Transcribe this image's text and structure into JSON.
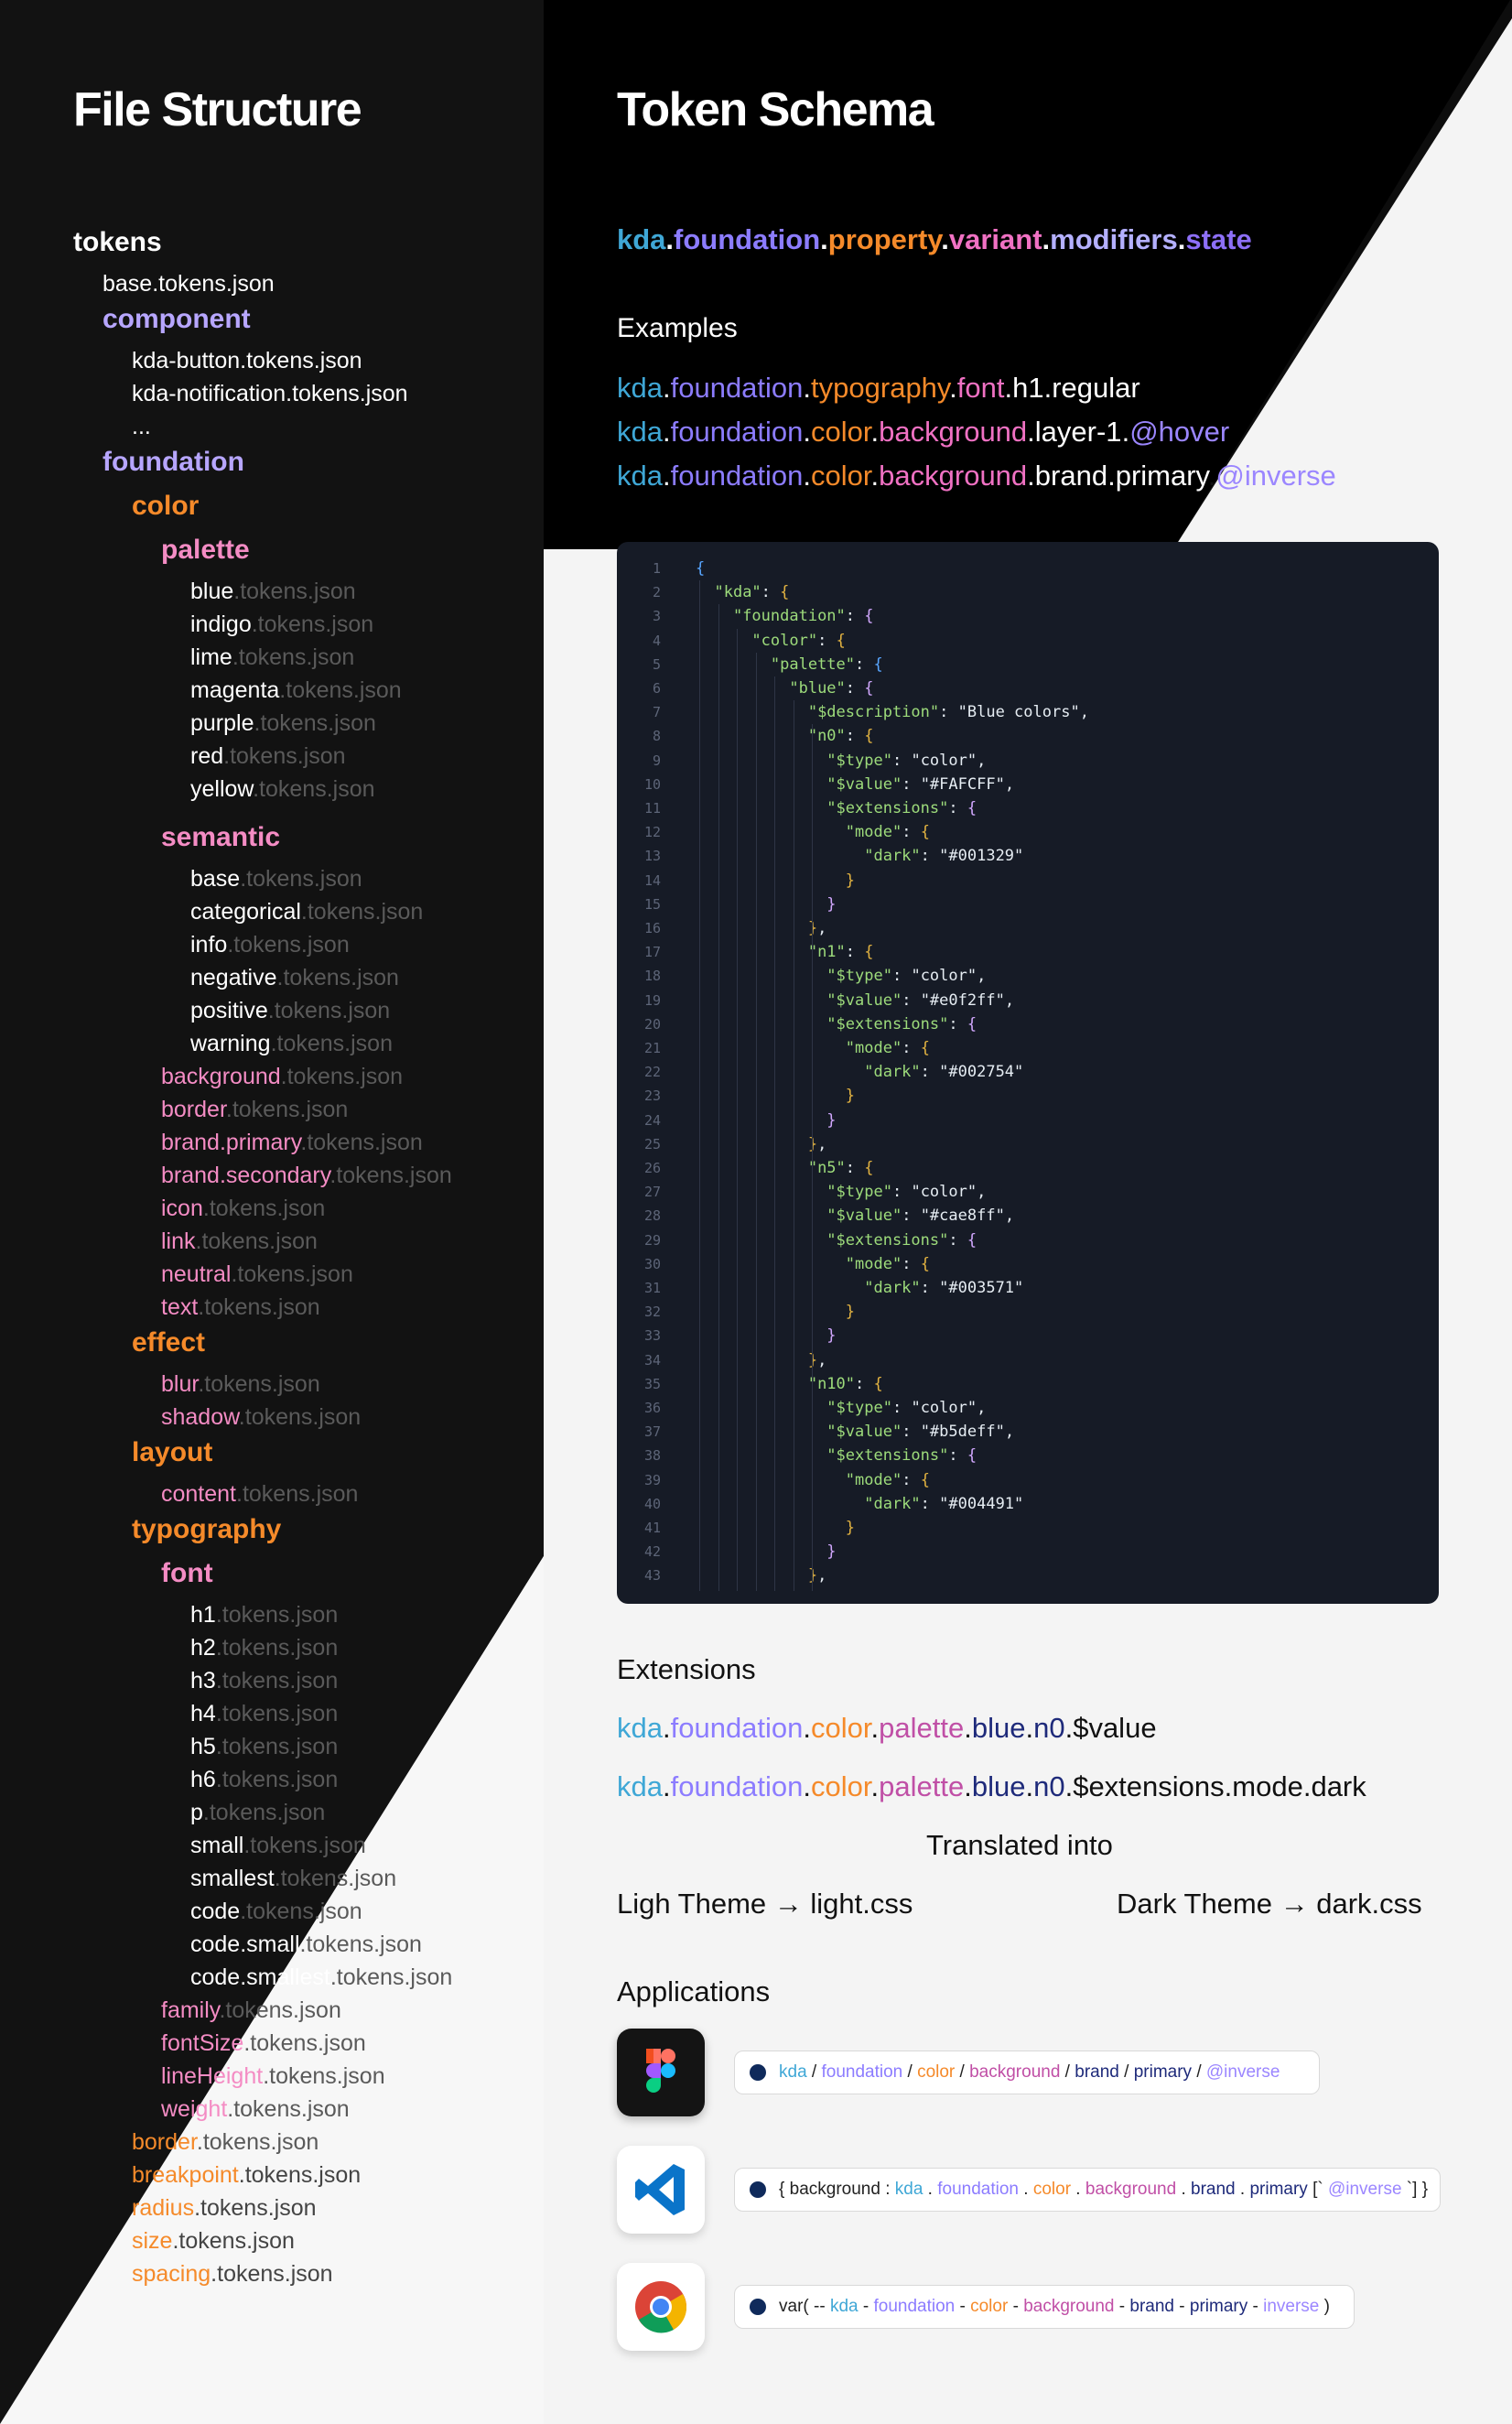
{
  "left_title": "File Structure",
  "right_title": "Token Schema",
  "tree": [
    {
      "name": "tokens",
      "ext": "",
      "style": "root",
      "indent": 0
    },
    {
      "name": "base.tokens.json",
      "ext": "",
      "style": "file",
      "indent": 1
    },
    {
      "name": "component",
      "ext": "",
      "style": "comp",
      "indent": 1
    },
    {
      "name": "kda-button.tokens.json",
      "ext": "",
      "style": "file",
      "indent": 2
    },
    {
      "name": "kda-notification.tokens.json",
      "ext": "",
      "style": "file",
      "indent": 2
    },
    {
      "name": "...",
      "ext": "",
      "style": "file",
      "indent": 2
    },
    {
      "name": "foundation",
      "ext": "",
      "style": "fnd",
      "indent": 1
    },
    {
      "name": "color",
      "ext": "",
      "style": "cat",
      "indent": 2
    },
    {
      "name": "palette",
      "ext": "",
      "style": "sub",
      "indent": 3
    },
    {
      "name": "blue",
      "ext": ".tokens.json",
      "style": "w",
      "indent": 4
    },
    {
      "name": "indigo",
      "ext": ".tokens.json",
      "style": "w",
      "indent": 4
    },
    {
      "name": "lime",
      "ext": ".tokens.json",
      "style": "w",
      "indent": 4
    },
    {
      "name": "magenta",
      "ext": ".tokens.json",
      "style": "w",
      "indent": 4
    },
    {
      "name": "purple",
      "ext": ".tokens.json",
      "style": "w",
      "indent": 4
    },
    {
      "name": "red",
      "ext": ".tokens.json",
      "style": "w",
      "indent": 4
    },
    {
      "name": "yellow",
      "ext": ".tokens.json",
      "style": "w",
      "indent": 4
    },
    {
      "name": "semantic",
      "ext": "",
      "style": "sub",
      "indent": 3
    },
    {
      "name": "base",
      "ext": ".tokens.json",
      "style": "w",
      "indent": 4
    },
    {
      "name": "categorical",
      "ext": ".tokens.json",
      "style": "w",
      "indent": 4
    },
    {
      "name": "info",
      "ext": ".tokens.json",
      "style": "w",
      "indent": 4
    },
    {
      "name": "negative",
      "ext": ".tokens.json",
      "style": "w",
      "indent": 4
    },
    {
      "name": "positive",
      "ext": ".tokens.json",
      "style": "w",
      "indent": 4
    },
    {
      "name": "warning",
      "ext": ".tokens.json",
      "style": "w",
      "indent": 4
    },
    {
      "name": "background",
      "ext": ".tokens.json",
      "style": "p",
      "indent": 3
    },
    {
      "name": "border",
      "ext": ".tokens.json",
      "style": "p",
      "indent": 3
    },
    {
      "name": "brand.primary",
      "ext": ".tokens.json",
      "style": "p",
      "indent": 3
    },
    {
      "name": "brand.secondary",
      "ext": ".tokens.json",
      "style": "p",
      "indent": 3
    },
    {
      "name": "icon",
      "ext": ".tokens.json",
      "style": "p",
      "indent": 3
    },
    {
      "name": "link",
      "ext": ".tokens.json",
      "style": "p",
      "indent": 3
    },
    {
      "name": "neutral",
      "ext": ".tokens.json",
      "style": "p",
      "indent": 3
    },
    {
      "name": "text",
      "ext": ".tokens.json",
      "style": "p",
      "indent": 3
    },
    {
      "name": "effect",
      "ext": "",
      "style": "cat",
      "indent": 2
    },
    {
      "name": "blur",
      "ext": ".tokens.json",
      "style": "p",
      "indent": 3
    },
    {
      "name": "shadow",
      "ext": ".tokens.json",
      "style": "p",
      "indent": 3
    },
    {
      "name": "layout",
      "ext": "",
      "style": "cat",
      "indent": 2
    },
    {
      "name": "content",
      "ext": ".tokens.json",
      "style": "p",
      "indent": 3
    },
    {
      "name": "typography",
      "ext": "",
      "style": "cat",
      "indent": 2
    },
    {
      "name": "font",
      "ext": "",
      "style": "sub",
      "indent": 3
    },
    {
      "name": "h1",
      "ext": ".tokens.json",
      "style": "w",
      "indent": 4
    },
    {
      "name": "h2",
      "ext": ".tokens.json",
      "style": "w",
      "indent": 4
    },
    {
      "name": "h3",
      "ext": ".tokens.json",
      "style": "w",
      "indent": 4
    },
    {
      "name": "h4",
      "ext": ".tokens.json",
      "style": "w",
      "indent": 4
    },
    {
      "name": "h5",
      "ext": ".tokens.json",
      "style": "w",
      "indent": 4
    },
    {
      "name": "h6",
      "ext": ".tokens.json",
      "style": "w",
      "indent": 4
    },
    {
      "name": "p",
      "ext": ".tokens.json",
      "style": "w",
      "indent": 4
    },
    {
      "name": "small",
      "ext": ".tokens.json",
      "style": "w",
      "indent": 4
    },
    {
      "name": "smallest",
      "ext": ".tokens.json",
      "style": "w",
      "indent": 4
    },
    {
      "name": "code",
      "ext": ".tokens.json",
      "style": "w",
      "indent": 4
    },
    {
      "name": "code.small",
      "ext": ".tokens.json",
      "style": "w",
      "indent": 4
    },
    {
      "name": "code.smallest",
      "ext": ".tokens.json",
      "style": "w",
      "indent": 4
    },
    {
      "name": "family",
      "ext": ".tokens.json",
      "style": "p",
      "indent": 3
    },
    {
      "name": "fontSize",
      "ext": ".tokens.json",
      "style": "p",
      "indent": 3
    },
    {
      "name": "lineHeight",
      "ext": ".tokens.json",
      "style": "p",
      "indent": 3
    },
    {
      "name": "weight",
      "ext": ".tokens.json",
      "style": "p",
      "indent": 3
    },
    {
      "name": "border",
      "ext": ".tokens.json",
      "style": "o",
      "indent": 2
    },
    {
      "name": "breakpoint",
      "ext": ".tokens.json",
      "style": "o",
      "indent": 2
    },
    {
      "name": "radius",
      "ext": ".tokens.json",
      "style": "o",
      "indent": 2
    },
    {
      "name": "size",
      "ext": ".tokens.json",
      "style": "o",
      "indent": 2
    },
    {
      "name": "spacing",
      "ext": ".tokens.json",
      "style": "o",
      "indent": 2
    }
  ],
  "schema": {
    "segments": [
      "kda",
      "foundation",
      "property",
      "variant",
      "modifiers",
      "state"
    ],
    "examples_label": "Examples",
    "examples": [
      [
        "kda",
        "foundation",
        "typography",
        "font",
        "h1",
        "regular"
      ],
      [
        "kda",
        "foundation",
        "color",
        "background",
        "layer-1",
        "@hover"
      ],
      [
        "kda",
        "foundation",
        "color",
        "background",
        "brand",
        "primary",
        "@inverse"
      ]
    ]
  },
  "code_lines": [
    "{",
    "  \"kda\": {",
    "    \"foundation\": {",
    "      \"color\": {",
    "        \"palette\": {",
    "          \"blue\": {",
    "            \"$description\": \"Blue colors\",",
    "            \"n0\": {",
    "              \"$type\": \"color\",",
    "              \"$value\": \"#FAFCFF\",",
    "              \"$extensions\": {",
    "                \"mode\": {",
    "                  \"dark\": \"#001329\"",
    "                }",
    "              }",
    "            },",
    "            \"n1\": {",
    "              \"$type\": \"color\",",
    "              \"$value\": \"#e0f2ff\",",
    "              \"$extensions\": {",
    "                \"mode\": {",
    "                  \"dark\": \"#002754\"",
    "                }",
    "              }",
    "            },",
    "            \"n5\": {",
    "              \"$type\": \"color\",",
    "              \"$value\": \"#cae8ff\",",
    "              \"$extensions\": {",
    "                \"mode\": {",
    "                  \"dark\": \"#003571\"",
    "                }",
    "              }",
    "            },",
    "            \"n10\": {",
    "              \"$type\": \"color\",",
    "              \"$value\": \"#b5deff\",",
    "              \"$extensions\": {",
    "                \"mode\": {",
    "                  \"dark\": \"#004491\"",
    "                }",
    "              }",
    "            },"
  ],
  "extensions": {
    "heading": "Extensions",
    "lines": [
      [
        "kda",
        "foundation",
        "color",
        "palette",
        "blue",
        "n0",
        "$value"
      ],
      [
        "kda",
        "foundation",
        "color",
        "palette",
        "blue",
        "n0",
        "$extensions",
        "mode",
        "dark"
      ]
    ],
    "translated": "Translated into",
    "light": "Ligh Theme → light.css",
    "dark": "Dark Theme → dark.css"
  },
  "applications": {
    "heading": "Applications",
    "apps": [
      {
        "icon": "figma-icon"
      },
      {
        "icon": "vscode-icon"
      },
      {
        "icon": "chrome-icon"
      }
    ]
  },
  "colors": {
    "kda": "#3fa7d6",
    "foundation": "#8c7cff",
    "property": "#f58a2a",
    "variant": "#f071c3",
    "modifiers": "#a6a0ff",
    "state": "#8d6ff7"
  }
}
